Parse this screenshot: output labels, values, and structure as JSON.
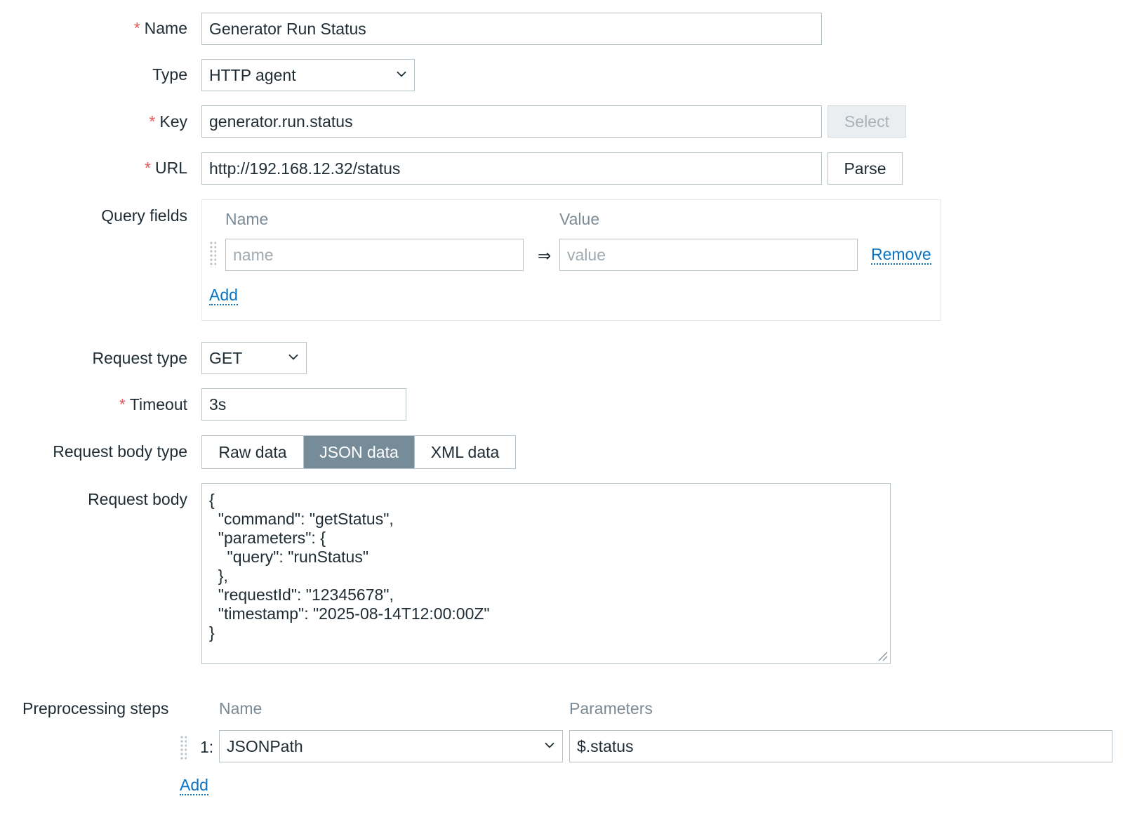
{
  "form": {
    "name": {
      "label": "Name",
      "required": "*",
      "value": "Generator Run Status"
    },
    "type": {
      "label": "Type",
      "value": "HTTP agent"
    },
    "key": {
      "label": "Key",
      "required": "*",
      "value": "generator.run.status",
      "button": "Select"
    },
    "url": {
      "label": "URL",
      "required": "*",
      "value": "http://192.168.12.32/status",
      "button": "Parse"
    },
    "query_fields": {
      "label": "Query fields",
      "col_name": "Name",
      "col_value": "Value",
      "name_placeholder": "name",
      "value_placeholder": "value",
      "arrow": "⇒",
      "remove": "Remove",
      "add": "Add"
    },
    "request_type": {
      "label": "Request type",
      "value": "GET"
    },
    "timeout": {
      "label": "Timeout",
      "required": "*",
      "value": "3s"
    },
    "request_body_type": {
      "label": "Request body type",
      "options": [
        "Raw data",
        "JSON data",
        "XML data"
      ],
      "selected": "JSON data"
    },
    "request_body": {
      "label": "Request body",
      "value": "{\n  \"command\": \"getStatus\",\n  \"parameters\": {\n    \"query\": \"runStatus\"\n  },\n  \"requestId\": \"12345678\",\n  \"timestamp\": \"2025-08-14T12:00:00Z\"\n}"
    },
    "preprocessing": {
      "label": "Preprocessing steps",
      "col_name": "Name",
      "col_params": "Parameters",
      "steps": [
        {
          "index": "1:",
          "name": "JSONPath",
          "param": "$.status"
        }
      ],
      "add": "Add"
    }
  }
}
